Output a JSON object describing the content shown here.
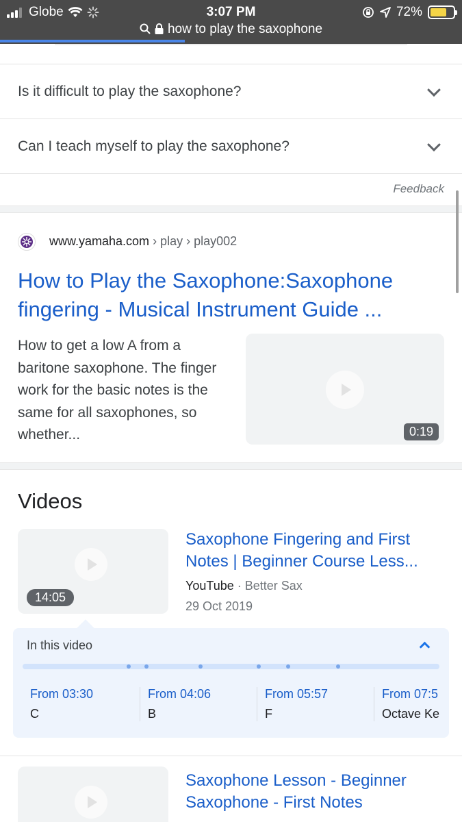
{
  "status_bar": {
    "carrier": "Globe",
    "time": "3:07 PM",
    "battery": "72%",
    "battery_level": 0.72
  },
  "address_bar": {
    "query": "how to play the saxophone"
  },
  "faq": {
    "items": [
      {
        "question": "Is it difficult to play the saxophone?"
      },
      {
        "question": "Can I teach myself to play the saxophone?"
      }
    ],
    "feedback": "Feedback"
  },
  "result": {
    "domain": "www.yamaha.com",
    "crumb1": " › play › ",
    "crumb2": "play002",
    "title": "How to Play the Saxophone:Saxophone fingering - Musical Instrument Guide ...",
    "snippet": "How to get a low A from a baritone saxophone. The finger work for the basic notes is the same for all saxophones, so whether...",
    "duration": "0:19"
  },
  "videos": {
    "heading": "Videos",
    "items": [
      {
        "title": "Saxophone Fingering and First Notes | Beginner Course Less...",
        "source": "YouTube",
        "channel": " · Better Sax",
        "date": "29 Oct 2019",
        "duration": "14:05"
      },
      {
        "title": "Saxophone Lesson - Beginner Saxophone - First Notes"
      }
    ],
    "in_this_video": {
      "heading": "In this video",
      "chapters": [
        {
          "time": "From 03:30",
          "label": "C"
        },
        {
          "time": "From 04:06",
          "label": "B"
        },
        {
          "time": "From 05:57",
          "label": "F"
        },
        {
          "time": "From 07:5",
          "label": "Octave Ke"
        }
      ]
    }
  },
  "colors": {
    "link": "#1a5ec9",
    "status_bar_bg": "#4a4a4a",
    "in_video_bg": "#eef4fd"
  }
}
